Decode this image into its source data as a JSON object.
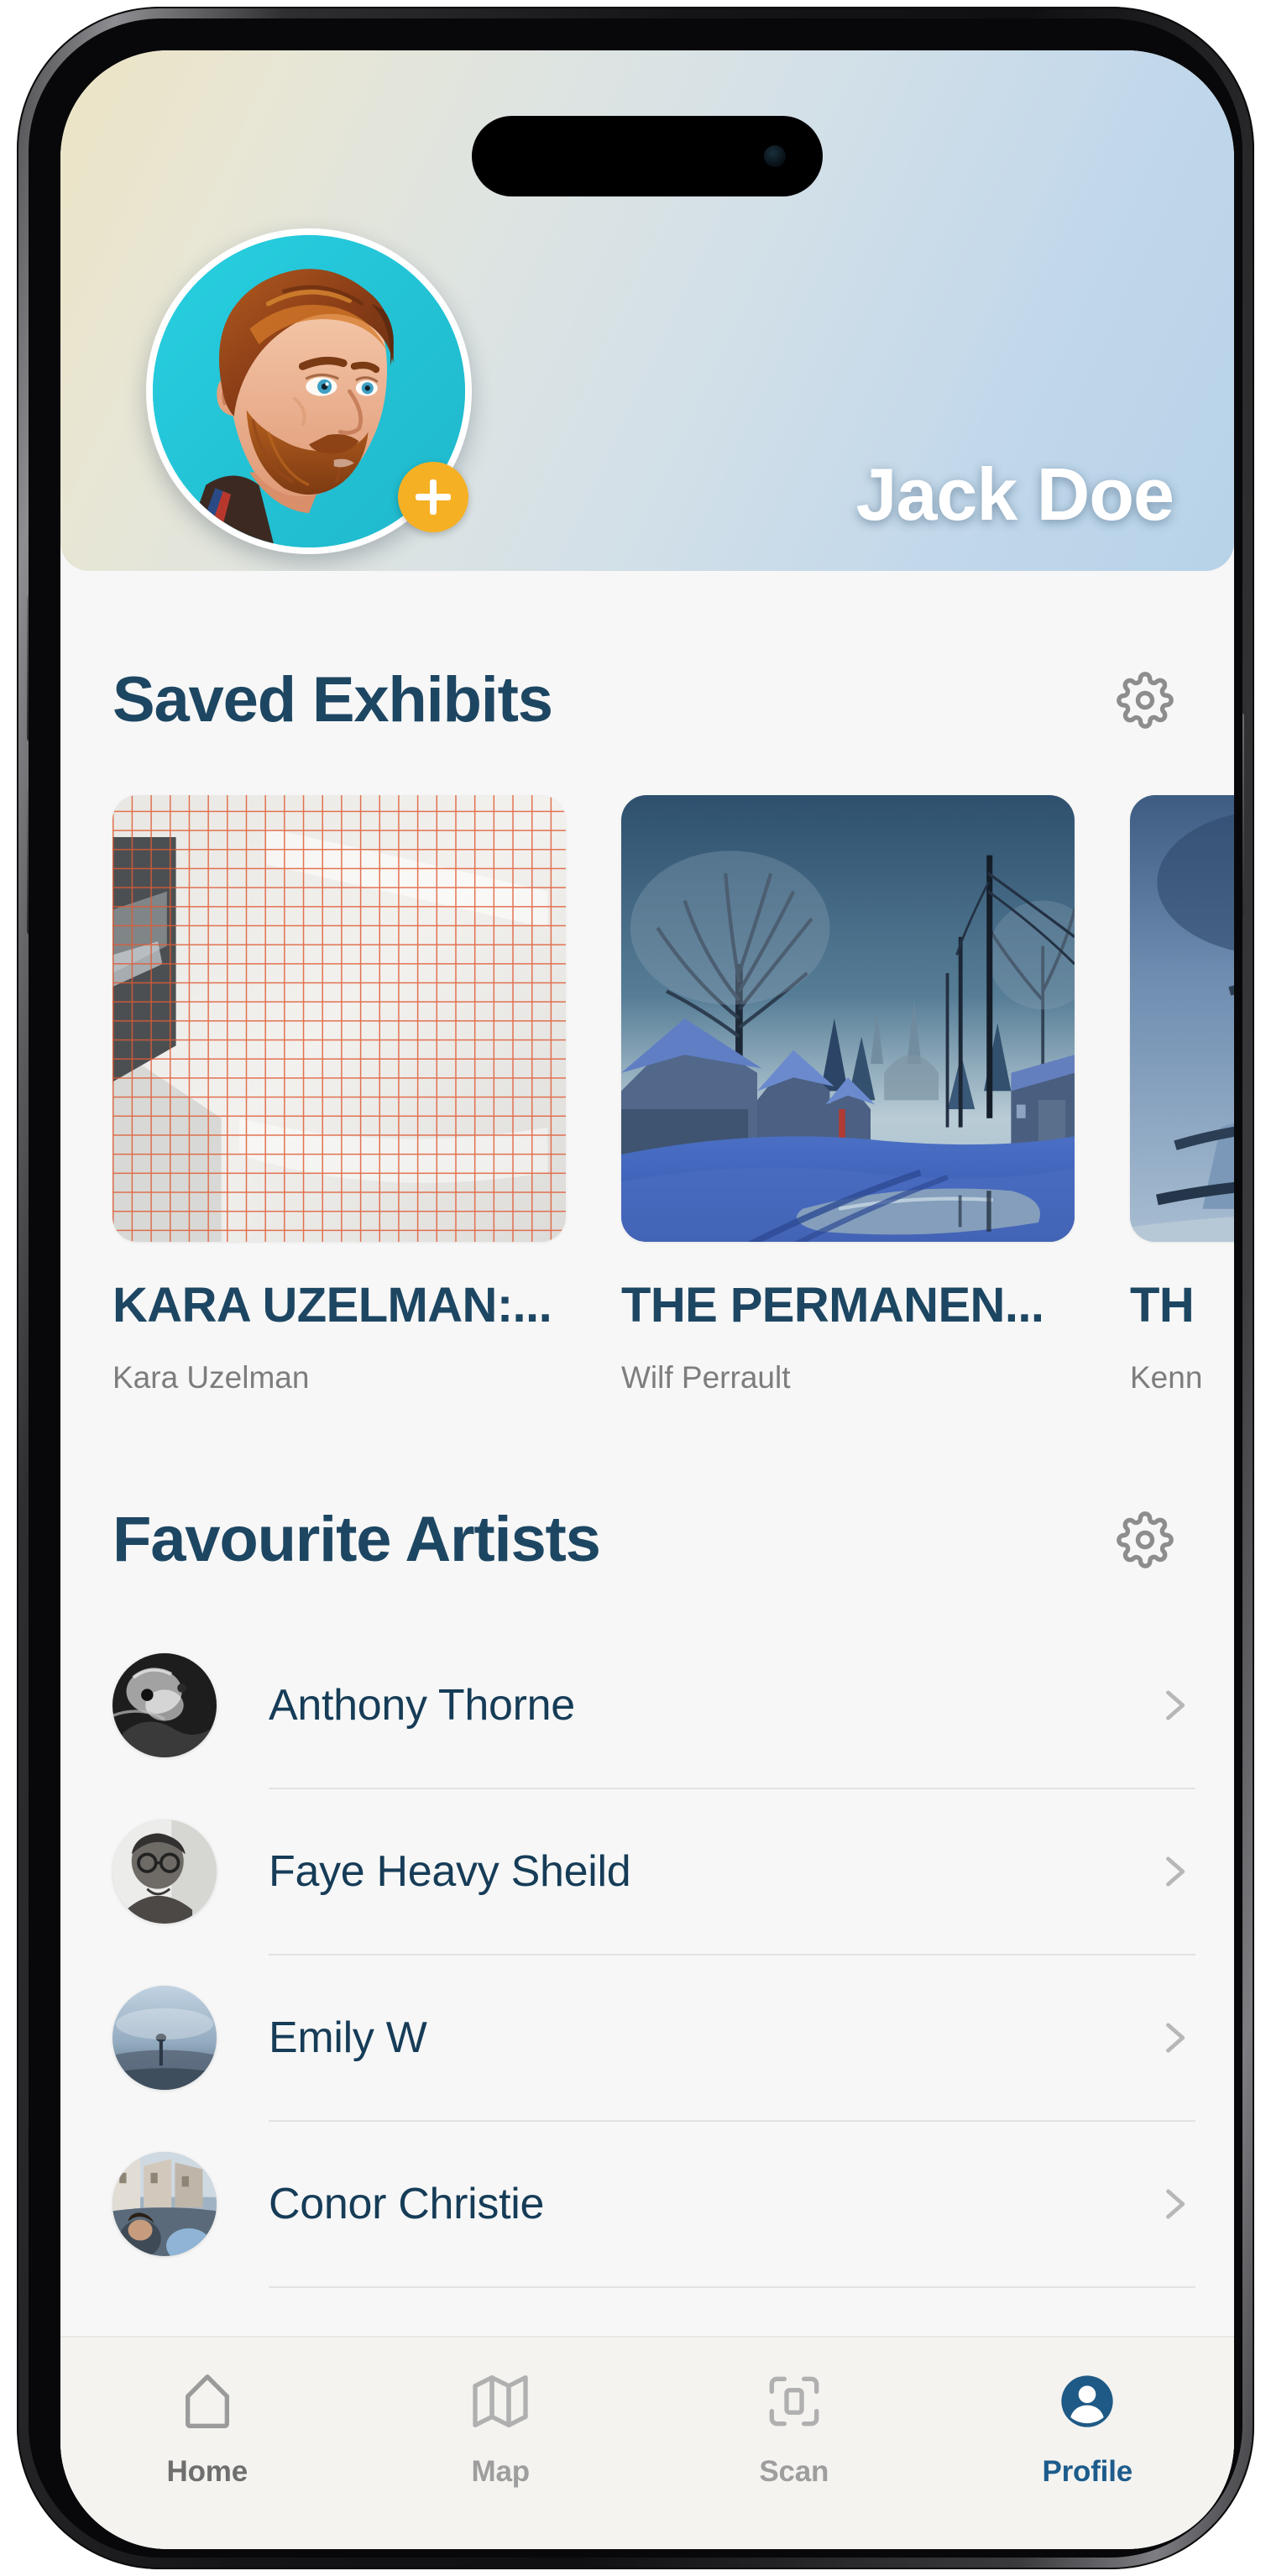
{
  "app": {
    "accent_color": "#1d4662",
    "active_tab_color": "#1d5c8c",
    "badge_color": "#f6b024",
    "screen_background": "#f7f7f7",
    "tabbar_background": "#f4f3f0"
  },
  "header": {
    "name": "Jack Doe",
    "avatar_icon": "user-avatar-portrait",
    "add_badge_icon": "plus-icon",
    "dynamic_island_icon": "dynamic-island"
  },
  "saved_exhibits": {
    "title": "Saved Exhibits",
    "settings_icon": "gear-icon",
    "items": [
      {
        "title": "KARA UZELMAN:...",
        "artist": "Kara Uzelman",
        "thumb_icon": "exhibit-thumb-grid-pattern"
      },
      {
        "title": "THE PERMANEN...",
        "artist": "Wilf Perrault",
        "thumb_icon": "exhibit-thumb-winter-alley"
      },
      {
        "title": "TH",
        "artist": "Kenn",
        "thumb_icon": "exhibit-thumb-blue-figures"
      }
    ]
  },
  "favourite_artists": {
    "title": "Favourite Artists",
    "settings_icon": "gear-icon",
    "chevron_icon": "chevron-right-icon",
    "items": [
      {
        "name": "Anthony Thorne",
        "avatar_icon": "artist-avatar-bw-portrait"
      },
      {
        "name": "Faye Heavy Sheild",
        "avatar_icon": "artist-avatar-bw-glasses"
      },
      {
        "name": "Emily W",
        "avatar_icon": "artist-avatar-misty-water"
      },
      {
        "name": "Conor Christie",
        "avatar_icon": "artist-avatar-street-selfie"
      }
    ]
  },
  "tab_bar": {
    "items": [
      {
        "label": "Home",
        "icon": "home-icon",
        "active": false
      },
      {
        "label": "Map",
        "icon": "map-icon",
        "active": false
      },
      {
        "label": "Scan",
        "icon": "scan-icon",
        "active": false
      },
      {
        "label": "Profile",
        "icon": "profile-icon",
        "active": true
      }
    ]
  }
}
